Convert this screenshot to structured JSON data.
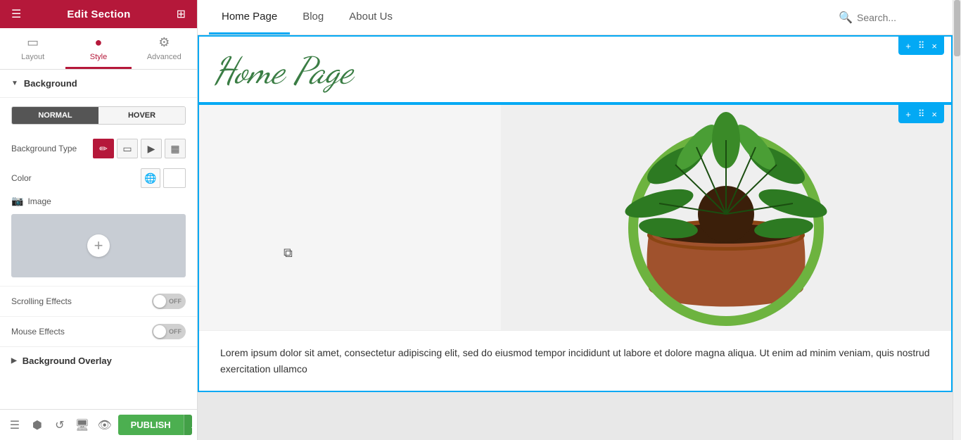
{
  "panel": {
    "header": {
      "title": "Edit Section",
      "menu_icon": "☰",
      "grid_icon": "⊞"
    },
    "tabs": [
      {
        "id": "layout",
        "label": "Layout",
        "icon": "▭"
      },
      {
        "id": "style",
        "label": "Style",
        "icon": "●",
        "active": true
      },
      {
        "id": "advanced",
        "label": "Advanced",
        "icon": "⚙"
      }
    ],
    "background_section": {
      "label": "Background",
      "normal_label": "NORMAL",
      "hover_label": "HOVER",
      "bg_type_label": "Background Type",
      "bg_types": [
        {
          "id": "color",
          "icon": "✏",
          "active": true
        },
        {
          "id": "gradient",
          "icon": "▭"
        },
        {
          "id": "video",
          "icon": "▶"
        },
        {
          "id": "image",
          "icon": "⊞"
        }
      ],
      "color_label": "Color",
      "image_label": "Image"
    },
    "scrolling_effects": {
      "label": "Scrolling Effects",
      "toggle_state": "OFF"
    },
    "mouse_effects": {
      "label": "Mouse Effects",
      "toggle_state": "OFF"
    },
    "background_overlay": {
      "label": "Background Overlay"
    }
  },
  "bottom_bar": {
    "icons": [
      "☰",
      "⬡",
      "↺",
      "🖥",
      "👁"
    ],
    "publish_label": "PUBLISH"
  },
  "main": {
    "nav_tabs": [
      {
        "id": "home",
        "label": "Home Page",
        "active": true
      },
      {
        "id": "blog",
        "label": "Blog"
      },
      {
        "id": "about",
        "label": "About Us"
      }
    ],
    "search_placeholder": "Search...",
    "section1": {
      "title": "Home Page",
      "toolbar_buttons": [
        "+",
        "⠿",
        "×"
      ]
    },
    "section2": {
      "toolbar_buttons": [
        "+",
        "⠿",
        "×"
      ]
    },
    "lorem_text": "Lorem ipsum dolor sit amet, consectetur adipiscing elit, sed do eiusmod tempor incididunt ut labore et dolore magna aliqua. Ut enim ad minim veniam, quis nostrud exercitation ullamco"
  }
}
